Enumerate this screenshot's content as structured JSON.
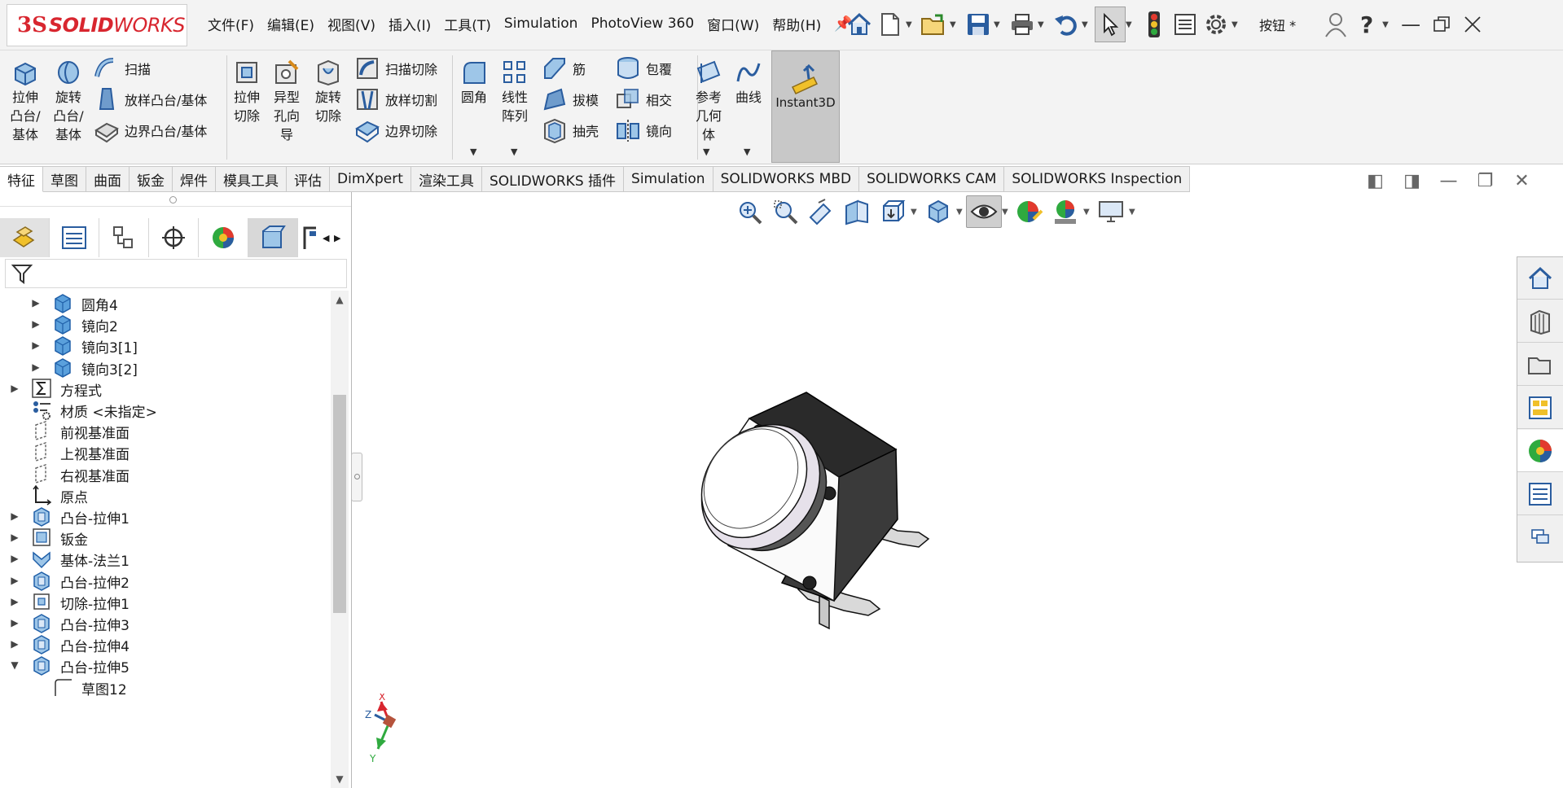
{
  "app": {
    "logo_ds": "3S",
    "logo_solid": "SOLID",
    "logo_works": "WORKS",
    "document_title": "按钮 *",
    "accent_color": "#d8262f"
  },
  "menus": [
    "文件(F)",
    "编辑(E)",
    "视图(V)",
    "插入(I)",
    "工具(T)",
    "Simulation",
    "PhotoView 360",
    "窗口(W)",
    "帮助(H)"
  ],
  "quick_access": {
    "icons": [
      "home-icon",
      "new-document-icon",
      "open-icon",
      "save-icon",
      "print-icon",
      "undo-icon",
      "select-icon",
      "rebuild-icon",
      "file-properties-icon",
      "options-icon"
    ],
    "help_label": "?"
  },
  "command_manager": {
    "extrude_boss": "拉伸\n凸台/\n基体",
    "revolve_boss": "旋转\n凸台/\n基体",
    "sweep": "扫描",
    "loft_boss": "放样凸台/基体",
    "boundary_boss": "边界凸台/基体",
    "extrude_cut": "拉伸\n切除",
    "hole_wizard": "异型\n孔向\n导",
    "revolve_cut": "旋转\n切除",
    "swept_cut": "扫描切除",
    "lofted_cut": "放样切割",
    "boundary_cut": "边界切除",
    "fillet": "圆角",
    "linear_pattern": "线性\n阵列",
    "rib": "筋",
    "draft": "拔模",
    "shell": "抽壳",
    "wrap": "包覆",
    "intersect": "相交",
    "mirror": "镜向",
    "reference_geometry": "参考\n几何\n体",
    "curves": "曲线",
    "instant3d": "Instant3D"
  },
  "tabs": [
    "特征",
    "草图",
    "曲面",
    "钣金",
    "焊件",
    "模具工具",
    "评估",
    "DimXpert",
    "渲染工具",
    "SOLIDWORKS 插件",
    "Simulation",
    "SOLIDWORKS MBD",
    "SOLIDWORKS CAM",
    "SOLIDWORKS Inspection"
  ],
  "active_tab": "特征",
  "feature_tree": {
    "items": [
      {
        "label": "圆角4",
        "icon": "feature-body-icon",
        "expandable": true,
        "expanded": false,
        "indent": 1
      },
      {
        "label": "镜向2",
        "icon": "feature-body-icon",
        "expandable": true,
        "expanded": false,
        "indent": 1
      },
      {
        "label": "镜向3[1]",
        "icon": "feature-body-icon",
        "expandable": true,
        "expanded": false,
        "indent": 1
      },
      {
        "label": "镜向3[2]",
        "icon": "feature-body-icon",
        "expandable": true,
        "expanded": false,
        "indent": 1
      },
      {
        "label": "方程式",
        "icon": "equations-icon",
        "expandable": true,
        "expanded": false,
        "indent": 0
      },
      {
        "label": "材质 <未指定>",
        "icon": "material-icon",
        "expandable": false,
        "expanded": false,
        "indent": 0
      },
      {
        "label": "前视基准面",
        "icon": "plane-icon",
        "expandable": false,
        "expanded": false,
        "indent": 0
      },
      {
        "label": "上视基准面",
        "icon": "plane-icon",
        "expandable": false,
        "expanded": false,
        "indent": 0
      },
      {
        "label": "右视基准面",
        "icon": "plane-icon",
        "expandable": false,
        "expanded": false,
        "indent": 0
      },
      {
        "label": "原点",
        "icon": "origin-icon",
        "expandable": false,
        "expanded": false,
        "indent": 0
      },
      {
        "label": "凸台-拉伸1",
        "icon": "extrude-icon",
        "expandable": true,
        "expanded": false,
        "indent": 0
      },
      {
        "label": "钣金",
        "icon": "sheet-metal-icon",
        "expandable": true,
        "expanded": false,
        "indent": 0
      },
      {
        "label": "基体-法兰1",
        "icon": "base-flange-icon",
        "expandable": true,
        "expanded": false,
        "indent": 0
      },
      {
        "label": "凸台-拉伸2",
        "icon": "extrude-icon",
        "expandable": true,
        "expanded": false,
        "indent": 0
      },
      {
        "label": "切除-拉伸1",
        "icon": "cut-extrude-icon",
        "expandable": true,
        "expanded": false,
        "indent": 0
      },
      {
        "label": "凸台-拉伸3",
        "icon": "extrude-icon",
        "expandable": true,
        "expanded": false,
        "indent": 0
      },
      {
        "label": "凸台-拉伸4",
        "icon": "extrude-icon",
        "expandable": true,
        "expanded": false,
        "indent": 0
      },
      {
        "label": "凸台-拉伸5",
        "icon": "extrude-icon",
        "expandable": true,
        "expanded": true,
        "indent": 0
      },
      {
        "label": "草图12",
        "icon": "sketch-icon",
        "expandable": false,
        "expanded": false,
        "indent": 1
      }
    ]
  },
  "triad": {
    "x": "X",
    "y": "Y",
    "z": "Z"
  }
}
